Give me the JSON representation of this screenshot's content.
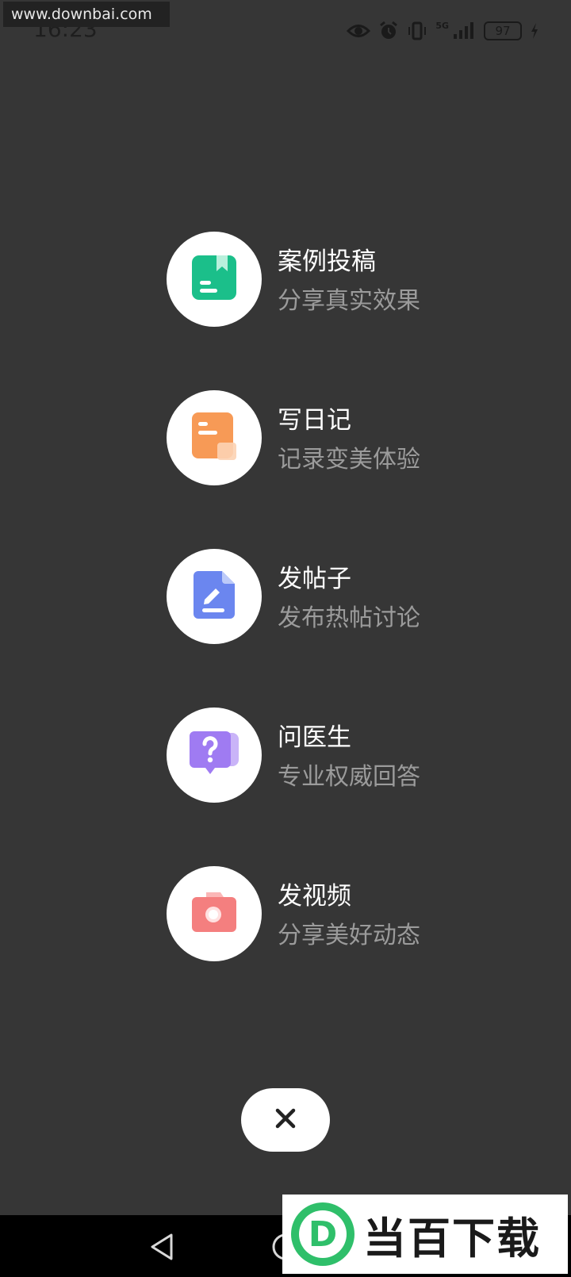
{
  "watermark": {
    "url": "www.downbai.com",
    "brand_text": "当百下载",
    "brand_letter": "D"
  },
  "status_bar": {
    "time": "16:23",
    "network_label": "5G",
    "battery": "97",
    "icons": [
      "eye-icon",
      "alarm-icon",
      "vibrate-icon",
      "signal-icon",
      "battery-icon",
      "charging-icon"
    ]
  },
  "menu": {
    "items": [
      {
        "title": "案例投稿",
        "subtitle": "分享真实效果",
        "icon": "case-book-icon",
        "color": "#1bbf8a"
      },
      {
        "title": "写日记",
        "subtitle": "记录变美体验",
        "icon": "diary-icon",
        "color": "#f79a56"
      },
      {
        "title": "发帖子",
        "subtitle": "发布热帖讨论",
        "icon": "post-edit-icon",
        "color": "#6b86ef"
      },
      {
        "title": "问医生",
        "subtitle": "专业权威回答",
        "icon": "question-bubble-icon",
        "color": "#9f7bf2"
      },
      {
        "title": "发视频",
        "subtitle": "分享美好动态",
        "icon": "camera-icon",
        "color": "#f47f7f"
      }
    ]
  },
  "close": {
    "icon": "close-icon"
  },
  "nav": {
    "back_icon": "back-triangle-icon",
    "home_icon": "home-circle-icon"
  }
}
